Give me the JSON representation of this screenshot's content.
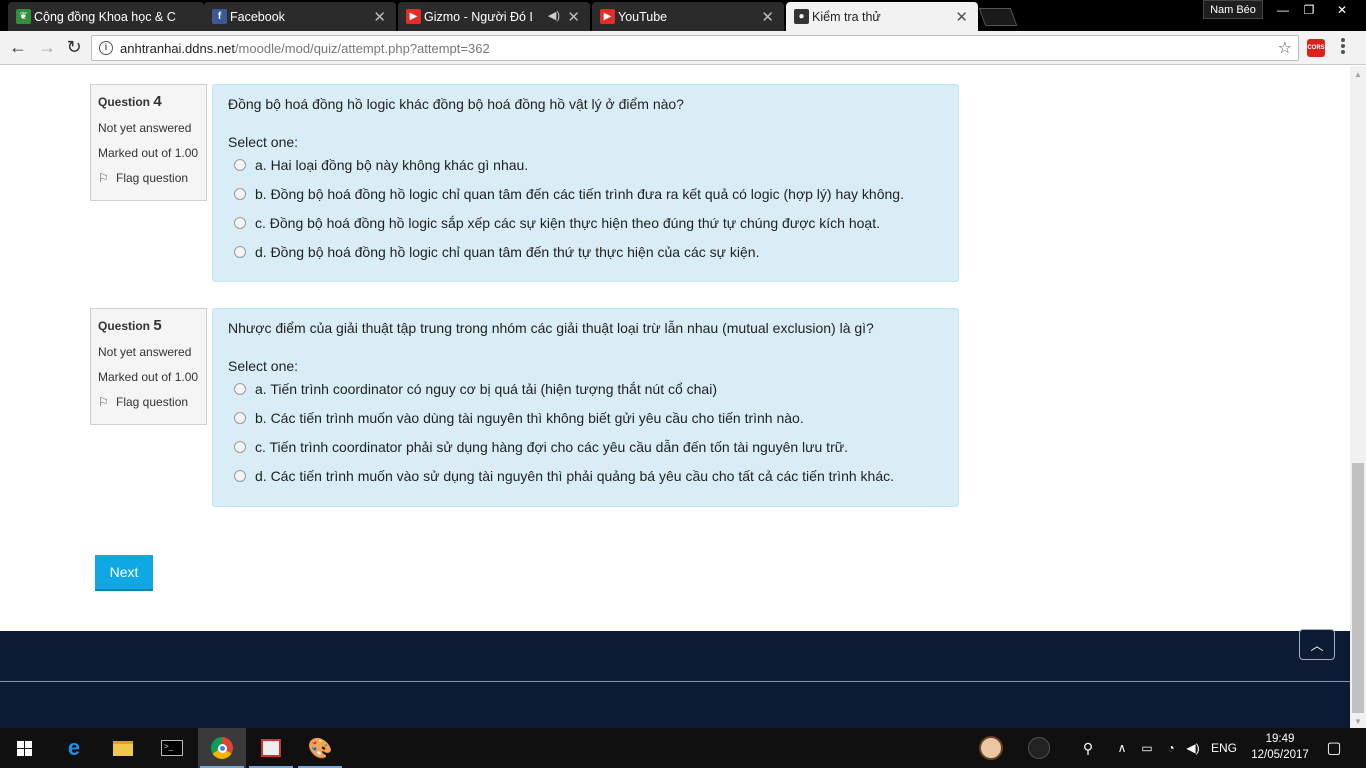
{
  "browser": {
    "tabs": [
      {
        "title": "Cộng đồng Khoa học & C",
        "icon": "leaf-icon",
        "active": false
      },
      {
        "title": "Facebook",
        "icon": "facebook-icon",
        "active": false
      },
      {
        "title": "Gizmo - Người Đó Là",
        "icon": "youtube-icon",
        "active": false
      },
      {
        "title": "YouTube",
        "icon": "youtube-icon",
        "active": false
      },
      {
        "title": "Kiểm tra thử",
        "icon": "moodle-icon",
        "active": true
      }
    ],
    "profile_name": "Nam Béo",
    "url_host": "anhtranhai.ddns.net",
    "url_path": "/moodle/mod/quiz/attempt.php?attempt=362",
    "extension_label": "CORS"
  },
  "questions": [
    {
      "label": "Question",
      "number": "4",
      "status": "Not yet answered",
      "marked": "Marked out of 1.00",
      "flag": "Flag question",
      "text": "Đồng bộ hoá đồng hồ logic khác đồng bộ hoá đồng hồ vật lý ở điểm nào?",
      "prompt": "Select one:",
      "answers": [
        "a. Hai loại đồng bộ này không khác gì nhau.",
        "b. Đồng bộ hoá đồng hồ logic chỉ quan tâm đến các tiến trình đưa ra kết quả có logic (hợp lý) hay không.",
        "c. Đồng bộ hoá đồng hồ logic sắp xếp các sự kiện thực hiện theo đúng thứ tự chúng được kích hoạt.",
        "d. Đồng bộ hoá đồng hồ logic chỉ quan tâm đến thứ tự thực hiện của các sự kiện."
      ]
    },
    {
      "label": "Question",
      "number": "5",
      "status": "Not yet answered",
      "marked": "Marked out of 1.00",
      "flag": "Flag question",
      "text": "Nhược điểm của giải thuật tập trung trong nhóm các giải thuật loại trừ lẫn nhau (mutual exclusion) là gì?",
      "prompt": "Select one:",
      "answers": [
        "a. Tiến trình coordinator có nguy cơ bị quá tải (hiện tượng thắt nút cổ chai)",
        "b. Các tiến trình muốn vào dùng tài nguyên thì không biết gửi yêu cầu cho tiến trình nào.",
        "c. Tiến trình coordinator phải sử dụng hàng đợi cho các yêu cầu dẫn đến tốn tài nguyên lưu trữ.",
        "d. Các tiến trình muốn vào sử dụng tài nguyên thì phải quảng bá yêu cầu cho tất cả các tiến trình khác."
      ]
    }
  ],
  "next_label": "Next",
  "taskbar": {
    "language": "ENG",
    "time": "19:49",
    "date": "12/05/2017"
  },
  "colors": {
    "question_bg": "#d9edf7",
    "next_button": "#0fa8e4",
    "footer": "#0c1b33"
  }
}
